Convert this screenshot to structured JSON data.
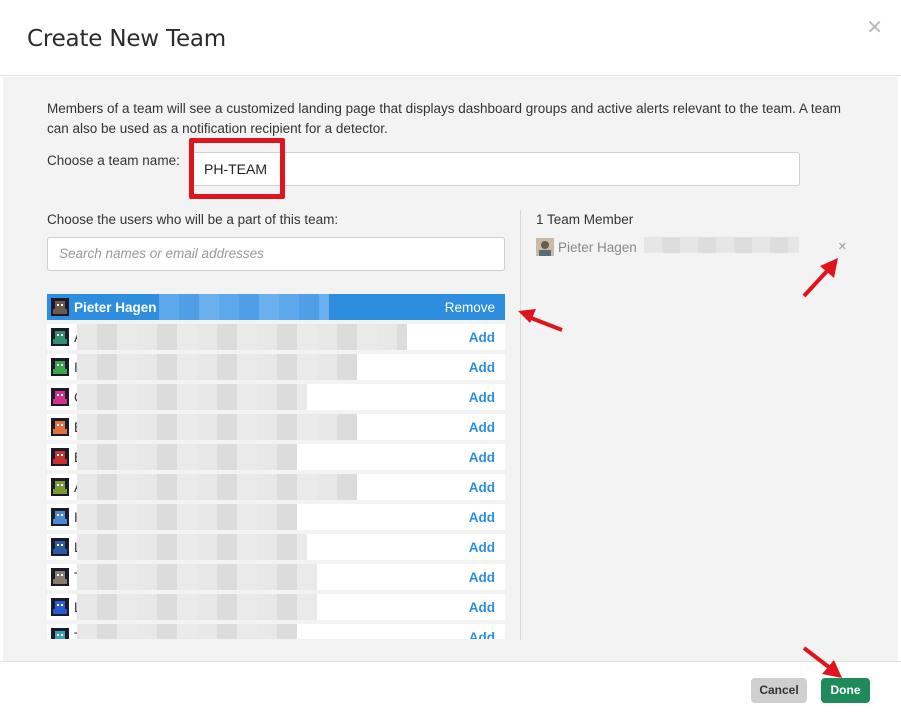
{
  "modal": {
    "title": "Create New Team",
    "close_icon": "close-icon"
  },
  "body": {
    "intro": "Members of a team will see a customized landing page that displays dashboard groups and active alerts relevant to the team. A team can also be used as a notification recipient for a detector.",
    "team_name_label": "Choose a team name:",
    "team_name_value": "PH-TEAM",
    "users_label": "Choose the users who will be a part of this team:",
    "search_placeholder": "Search names or email addresses"
  },
  "user_list": {
    "rows": [
      {
        "name": "Pieter Hagen",
        "action": "Remove",
        "selected": true,
        "avatar_color": "#6b5a4a"
      },
      {
        "name": "A",
        "action": "Add",
        "selected": false,
        "avatar_color": "#2f8f6f"
      },
      {
        "name": "I",
        "action": "Add",
        "selected": false,
        "avatar_color": "#3aa64a"
      },
      {
        "name": "C",
        "action": "Add",
        "selected": false,
        "avatar_color": "#d0318a"
      },
      {
        "name": "E",
        "action": "Add",
        "selected": false,
        "avatar_color": "#e07040"
      },
      {
        "name": "E",
        "action": "Add",
        "selected": false,
        "avatar_color": "#c8322e"
      },
      {
        "name": "A",
        "action": "Add",
        "selected": false,
        "avatar_color": "#7a9a3a"
      },
      {
        "name": "I",
        "action": "Add",
        "selected": false,
        "avatar_color": "#4a8ad0"
      },
      {
        "name": "L",
        "action": "Add",
        "selected": false,
        "avatar_color": "#2a5aa0"
      },
      {
        "name": "T",
        "action": "Add",
        "selected": false,
        "avatar_color": "#8a7a6a"
      },
      {
        "name": "L",
        "action": "Add",
        "selected": false,
        "avatar_color": "#2a5ad0"
      },
      {
        "name": "T",
        "action": "Add",
        "selected": false,
        "avatar_color": "#3aa0c0"
      }
    ]
  },
  "members": {
    "count_label": "1 Team Member",
    "items": [
      {
        "name": "Pieter Hagen",
        "remove_icon": "×",
        "avatar_color": "#6b5a4a"
      }
    ]
  },
  "footer": {
    "cancel_label": "Cancel",
    "done_label": "Done"
  },
  "colors": {
    "accent_blue": "#2d8ee0",
    "done_green": "#1f8a5a",
    "highlight_red": "#e0141c"
  }
}
